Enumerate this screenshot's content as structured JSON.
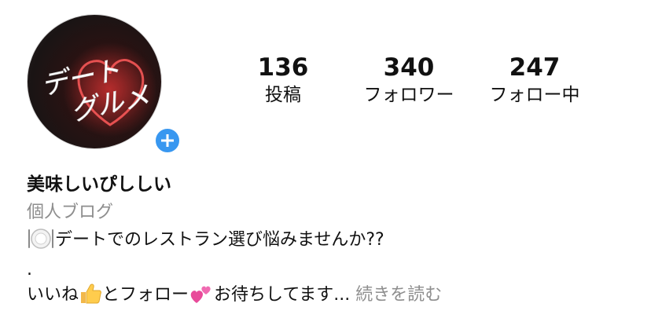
{
  "profile": {
    "avatar_text_line1": "デート",
    "avatar_text_line2": "グルメ",
    "name": "美味しいぴししい",
    "category": "個人ブログ"
  },
  "stats": [
    {
      "value": "136",
      "label": "投稿"
    },
    {
      "value": "340",
      "label": "フォロワー"
    },
    {
      "value": "247",
      "label": "フォロー中"
    }
  ],
  "bio": {
    "line1_text": "デートでのレストラン選び悩みませんか??",
    "line2_text": ".",
    "line3_part1": "いいね",
    "line3_part2": "とフォロー",
    "line3_part3": "お待ちしてます...",
    "more_label": "続きを読む"
  },
  "icons": {
    "plate": "fork-knife-plate-icon",
    "thumbs": "thumbs-up-icon",
    "hearts": "two-hearts-icon",
    "add": "plus-icon"
  },
  "colors": {
    "accent": "#3897f0",
    "muted": "#8e8e8e"
  }
}
